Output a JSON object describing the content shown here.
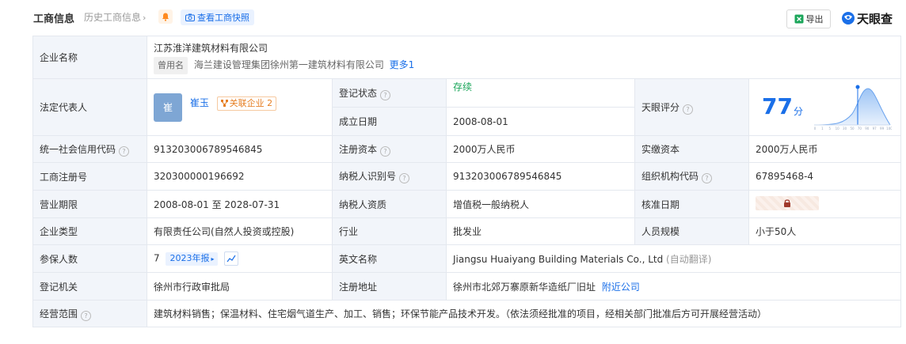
{
  "header": {
    "title": "工商信息",
    "history_label": "历史工商信息",
    "snapshot_label": "查看工商快照",
    "export_label": "导出",
    "brand": "天眼查"
  },
  "company": {
    "name_label": "企业名称",
    "name": "江苏淮洋建筑材料有限公司",
    "former_tag": "曾用名",
    "former_name": "海兰建设管理集团徐州第一建筑材料有限公司",
    "more": "更多1",
    "legal_label": "法定代表人",
    "avatar_text": "崔",
    "legal_name": "崔玉",
    "related_label": "关联企业",
    "related_count": "2",
    "reg_status_label": "登记状态",
    "reg_status": "存续",
    "found_date_label": "成立日期",
    "found_date": "2008-08-01",
    "score_label": "天眼评分",
    "score": "77",
    "score_unit": "分",
    "score_axis": [
      "0",
      "1",
      "5",
      "10",
      "30",
      "50",
      "70",
      "90",
      "97",
      "99",
      "100"
    ],
    "credit_code_label": "统一社会信用代码",
    "credit_code": "913203006789546845",
    "reg_capital_label": "注册资本",
    "reg_capital": "2000万人民币",
    "paid_capital_label": "实缴资本",
    "paid_capital": "2000万人民币",
    "reg_no_label": "工商注册号",
    "reg_no": "320300000196692",
    "taxpayer_id_label": "纳税人识别号",
    "taxpayer_id": "913203006789546845",
    "org_code_label": "组织机构代码",
    "org_code": "67895468-4",
    "term_label": "营业期限",
    "term_start": "2008-08-01",
    "term_to": "至",
    "term_end": "2028-07-31",
    "taxpayer_qual_label": "纳税人资质",
    "taxpayer_qual": "增值税一般纳税人",
    "approve_date_label": "核准日期",
    "type_label": "企业类型",
    "type": "有限责任公司(自然人投资或控股)",
    "industry_label": "行业",
    "industry": "批发业",
    "staff_label": "人员规模",
    "staff": "小于50人",
    "insured_label": "参保人数",
    "insured": "7",
    "insured_year": "2023年报",
    "en_name_label": "英文名称",
    "en_name": "Jiangsu Huaiyang Building Materials Co., Ltd",
    "auto_translate": "(自动翻译)",
    "authority_label": "登记机关",
    "authority": "徐州市行政审批局",
    "address_label": "注册地址",
    "address": "徐州市北郊万寨原新华造纸厂旧址",
    "nearby": "附近公司",
    "scope_label": "经营范围",
    "scope": "建筑材料销售；保温材料、住宅烟气道生产、加工、销售；环保节能产品技术开发。（依法须经批准的项目，经相关部门批准后方可开展经营活动）"
  },
  "colors": {
    "accent": "#1a6fe8",
    "label_bg": "#f2f5fa",
    "status_green": "#1ba65a"
  }
}
